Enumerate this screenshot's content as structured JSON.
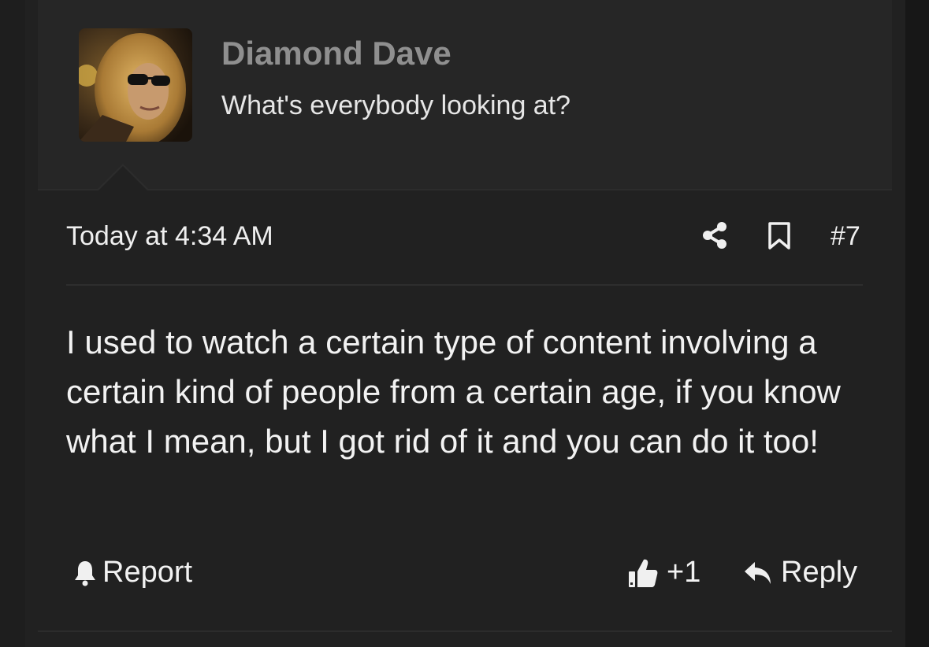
{
  "post": {
    "author": {
      "name": "Diamond Dave",
      "user_title": "What's everybody looking at?",
      "avatar": "user-avatar-photo"
    },
    "date": "Today at 4:34 AM",
    "number": "#7",
    "message": "I used to watch a certain type of content involving a certain kind of people from a certain age, if you know what I mean, but I got rid of it and you can do it too!",
    "actions": {
      "report_label": "Report",
      "like_label": "+1",
      "reply_label": "Reply"
    },
    "icons": {
      "share": "share-icon",
      "bookmark": "bookmark-icon",
      "report": "bell-icon",
      "like": "thumbs-up-icon",
      "reply": "reply-arrow-icon"
    }
  },
  "colors": {
    "page_background": "#1b1b1b",
    "card_background": "#212121",
    "user_block_background": "#262626",
    "username_color": "#8f8f8f",
    "text_color": "#f2f2f2"
  }
}
